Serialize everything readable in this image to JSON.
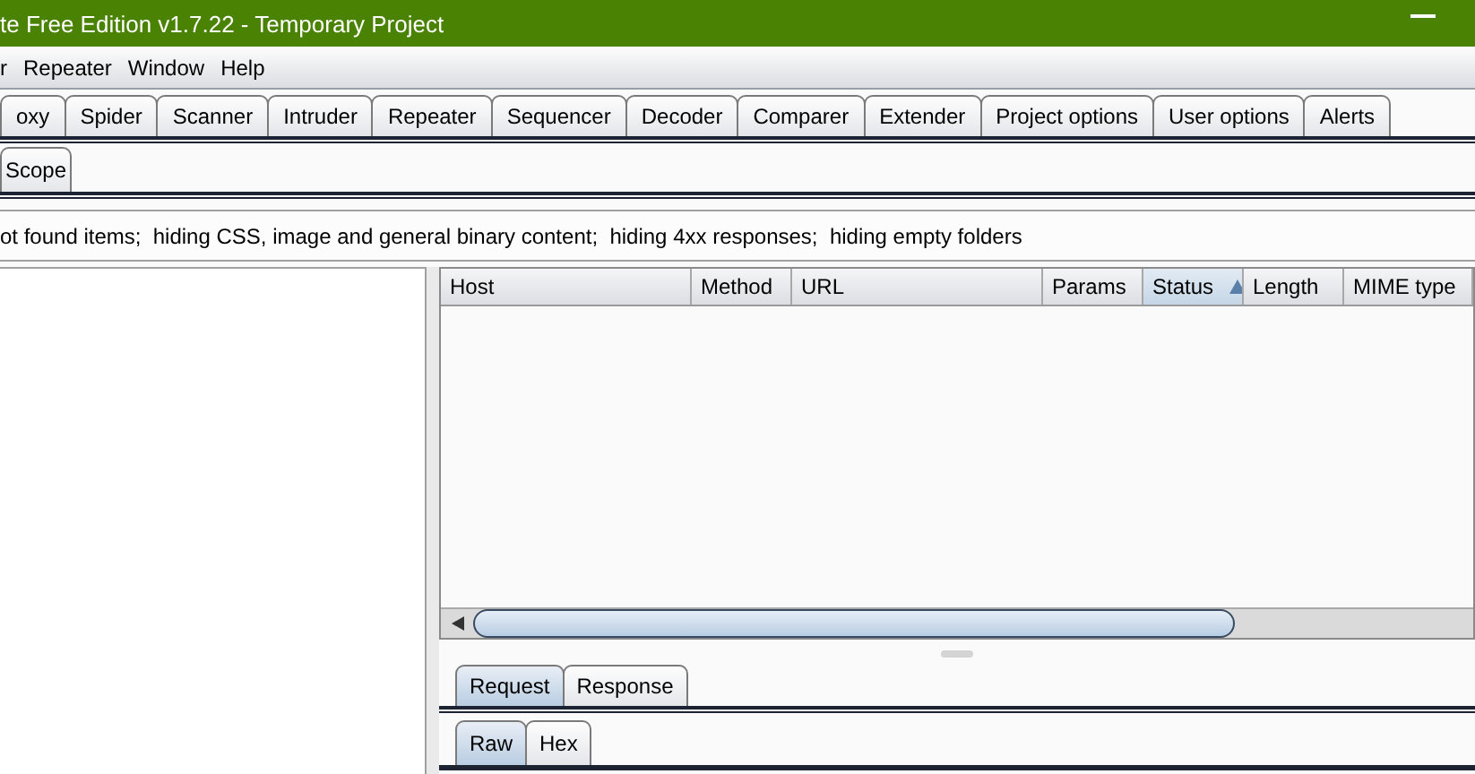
{
  "window": {
    "title": "te Free Edition v1.7.22 - Temporary Project"
  },
  "menu": [
    "r",
    "Repeater",
    "Window",
    "Help"
  ],
  "tabs": [
    {
      "label": "oxy",
      "selected": false
    },
    {
      "label": "Spider",
      "selected": false
    },
    {
      "label": "Scanner",
      "selected": false
    },
    {
      "label": "Intruder",
      "selected": false
    },
    {
      "label": "Repeater",
      "selected": false
    },
    {
      "label": "Sequencer",
      "selected": false
    },
    {
      "label": "Decoder",
      "selected": false
    },
    {
      "label": "Comparer",
      "selected": false
    },
    {
      "label": "Extender",
      "selected": false
    },
    {
      "label": "Project options",
      "selected": false
    },
    {
      "label": "User options",
      "selected": false
    },
    {
      "label": "Alerts",
      "selected": false
    }
  ],
  "subtabs": [
    {
      "label": "Scope",
      "selected": false
    }
  ],
  "filter": "ot found items;  hiding CSS, image and general binary content;  hiding 4xx responses;  hiding empty folders",
  "table": {
    "columns": [
      {
        "label": "Host",
        "sorted": false
      },
      {
        "label": "Method",
        "sorted": false
      },
      {
        "label": "URL",
        "sorted": false
      },
      {
        "label": "Params",
        "sorted": false
      },
      {
        "label": "Status",
        "sorted": true
      },
      {
        "label": "Length",
        "sorted": false
      },
      {
        "label": "MIME type",
        "sorted": false
      }
    ]
  },
  "message_tabs": [
    {
      "label": "Request",
      "selected": true
    },
    {
      "label": "Response",
      "selected": false
    }
  ],
  "view_tabs": [
    {
      "label": "Raw",
      "selected": true
    },
    {
      "label": "Hex",
      "selected": false
    }
  ]
}
